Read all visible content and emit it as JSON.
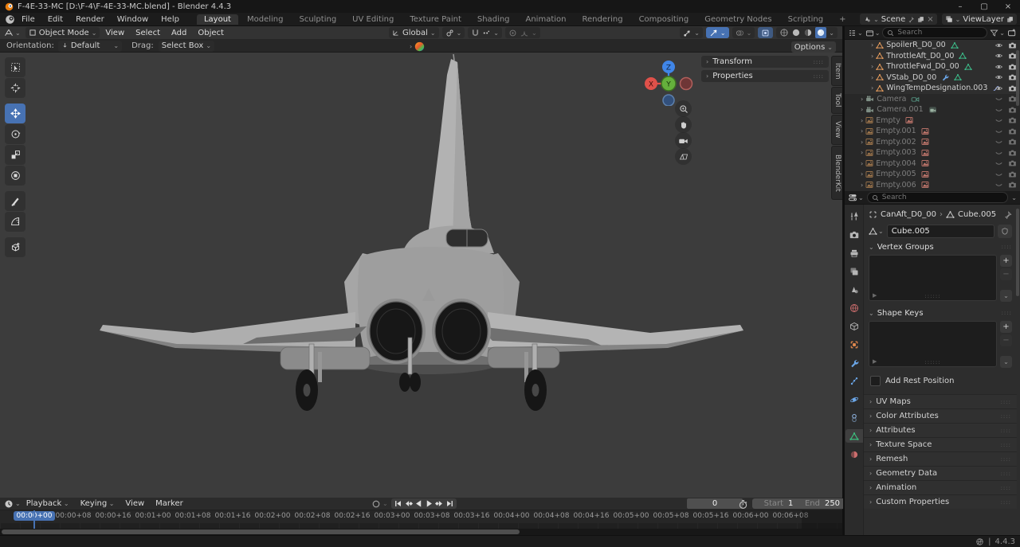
{
  "window": {
    "title": "F-4E-33-MC [D:\\F-4\\F-4E-33-MC.blend] - Blender 4.4.3",
    "controls": [
      "minimize",
      "maximize",
      "close"
    ]
  },
  "topbar": {
    "menus": [
      "File",
      "Edit",
      "Render",
      "Window",
      "Help"
    ],
    "workspaces": [
      "Layout",
      "Modeling",
      "Sculpting",
      "UV Editing",
      "Texture Paint",
      "Shading",
      "Animation",
      "Rendering",
      "Compositing",
      "Geometry Nodes",
      "Scripting"
    ],
    "active_workspace": "Layout",
    "add_workspace_label": "+",
    "scene_name": "Scene",
    "view_layer_name": "ViewLayer"
  },
  "viewport": {
    "header": {
      "mode": "Object Mode",
      "menus": [
        "View",
        "Select",
        "Add",
        "Object"
      ],
      "orientation": "Global"
    },
    "tool_settings": {
      "orientation_label": "Orientation:",
      "orientation_value": "Default",
      "drag_label": "Drag:",
      "drag_value": "Select Box",
      "options_label": "Options"
    },
    "toolbar": [
      "select-box",
      "cursor",
      "move",
      "rotate",
      "scale",
      "transform",
      "annotate",
      "measure",
      "add-cube"
    ],
    "active_tool": "move",
    "npanel_sections": [
      "Transform",
      "Properties"
    ],
    "npanel_tabs": [
      "Item",
      "Tool",
      "View",
      "BlenderKit"
    ],
    "gizmo_axes": {
      "x": "X",
      "y": "Y",
      "z": "Z"
    },
    "nav_buttons": [
      "zoom",
      "pan",
      "camera-view",
      "toggle-ortho"
    ]
  },
  "outliner": {
    "search_placeholder": "Search",
    "items": [
      {
        "label": "SpoilerR_D0_00",
        "icon": "mesh",
        "extras": [
          "vgroup"
        ],
        "dim": false,
        "eye": "open"
      },
      {
        "label": "ThrottleAft_D0_00",
        "icon": "mesh",
        "extras": [
          "vgroup"
        ],
        "dim": false,
        "eye": "open"
      },
      {
        "label": "ThrottleFwd_D0_00",
        "icon": "mesh",
        "extras": [
          "vgroup"
        ],
        "dim": false,
        "eye": "open"
      },
      {
        "label": "VStab_D0_00",
        "icon": "mesh",
        "extras": [
          "wrench",
          "vgroup"
        ],
        "dim": false,
        "eye": "open"
      },
      {
        "label": "WingTempDesignation.003",
        "icon": "mesh",
        "extras": [
          "curve"
        ],
        "dim": false,
        "eye": "open"
      },
      {
        "label": "Camera",
        "icon": "camera",
        "extras": [
          "camera-data"
        ],
        "dim": true,
        "eye": "closed"
      },
      {
        "label": "Camera.001",
        "icon": "camera",
        "extras": [
          "camera-badge"
        ],
        "dim": true,
        "eye": "closed"
      },
      {
        "label": "Empty",
        "icon": "empty-image",
        "extras": [
          "image-data"
        ],
        "dim": true,
        "eye": "closed"
      },
      {
        "label": "Empty.001",
        "icon": "empty-image",
        "extras": [
          "image-data"
        ],
        "dim": true,
        "eye": "closed"
      },
      {
        "label": "Empty.002",
        "icon": "empty-image",
        "extras": [
          "image-data"
        ],
        "dim": true,
        "eye": "closed"
      },
      {
        "label": "Empty.003",
        "icon": "empty-image",
        "extras": [
          "image-data"
        ],
        "dim": true,
        "eye": "closed"
      },
      {
        "label": "Empty.004",
        "icon": "empty-image",
        "extras": [
          "image-data"
        ],
        "dim": true,
        "eye": "closed"
      },
      {
        "label": "Empty.005",
        "icon": "empty-image",
        "extras": [
          "image-data"
        ],
        "dim": true,
        "eye": "closed"
      },
      {
        "label": "Empty.006",
        "icon": "empty-image",
        "extras": [
          "image-data"
        ],
        "dim": true,
        "eye": "closed"
      }
    ]
  },
  "properties": {
    "search_placeholder": "Search",
    "tabs": [
      "tool",
      "render",
      "output",
      "view-layer",
      "scene",
      "world",
      "collection",
      "object",
      "modifiers",
      "particles",
      "physics",
      "constraints",
      "object-data",
      "material"
    ],
    "active_tab": "object-data",
    "breadcrumb": {
      "object": "CanAft_D0_00",
      "separator": "›",
      "data": "Cube.005"
    },
    "name_value": "Cube.005",
    "sections": {
      "vertex_groups": "Vertex Groups",
      "shape_keys": "Shape Keys",
      "add_rest_position": "Add Rest Position",
      "collapsed": [
        "UV Maps",
        "Color Attributes",
        "Attributes",
        "Texture Space",
        "Remesh",
        "Geometry Data",
        "Animation",
        "Custom Properties"
      ]
    }
  },
  "timeline": {
    "menus": [
      {
        "label": "Playback",
        "dropdown": true
      },
      {
        "label": "Keying",
        "dropdown": true
      },
      {
        "label": "View",
        "dropdown": false
      },
      {
        "label": "Marker",
        "dropdown": false
      }
    ],
    "transport": [
      "jump-start",
      "prev-keyframe",
      "play-reverse",
      "play",
      "next-keyframe",
      "jump-end"
    ],
    "current_frame": "0",
    "start_label": "Start",
    "start_value": "1",
    "end_label": "End",
    "end_value": "250",
    "ticks": [
      "00:00+00",
      "00:00+08",
      "00:00+16",
      "00:01+00",
      "00:01+08",
      "00:01+16",
      "00:02+00",
      "00:02+08",
      "00:02+16",
      "00:03+00",
      "00:03+08",
      "00:03+16",
      "00:04+00",
      "00:04+08",
      "00:04+16",
      "00:05+00",
      "00:05+08",
      "00:05+16",
      "00:06+00",
      "00:06+08"
    ],
    "active_tick_index": 0
  },
  "statusbar": {
    "version": "4.4.3"
  },
  "colors": {
    "accent": "#4772b3",
    "axis_x": "#e0514a",
    "axis_y": "#65b03c",
    "axis_z": "#4086e8",
    "mesh_icon": "#e39b5c",
    "vgroup_icon": "#3dbd8a",
    "modifier_icon": "#6ba6e8",
    "data_icon": "#3dbd7d",
    "image_icon": "#c97a6f"
  }
}
